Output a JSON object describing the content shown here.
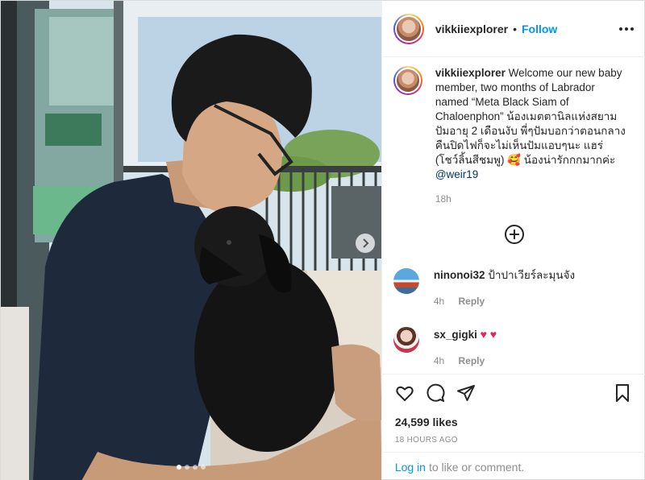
{
  "post": {
    "author": "vikkiiexplorer",
    "separator": "•",
    "follow_label": "Follow",
    "more_icon": "more-options-icon"
  },
  "caption": {
    "username": "vikkiiexplorer",
    "text": "Welcome our new baby member, two months of Labrador named “Meta Black Siam of Chaloenphon” น้องเมตตานิลแห่งสยาม ปัมอายุ 2 เดือนงับ พี่ๆปัมบอกว่าตอนกลางคืนปิดไฟก็จะไม่เห็นปัมแอบๆนะ แฮร่ (โชว์ลิ้นสีชมพู) 🥰 น้องน่ารักกกมากค่ะ",
    "mention": "@weir19",
    "age": "18h"
  },
  "comments": [
    {
      "username": "ninonoi32",
      "text": "ป้าปาเวียร์ละมุนจัง",
      "age": "4h",
      "reply": "Reply"
    },
    {
      "username": "sx_gigki",
      "text": "♥ ♥",
      "age": "4h",
      "reply": "Reply"
    }
  ],
  "likes": "24,599 likes",
  "time_ago": "18 HOURS AGO",
  "login": {
    "link": "Log in",
    "rest": "to like or comment."
  },
  "carousel": {
    "count": 4,
    "active": 0
  },
  "colors": {
    "accent": "#0095f6",
    "text": "#262626",
    "muted": "#8e8e8e",
    "heart": "#e0245e"
  }
}
